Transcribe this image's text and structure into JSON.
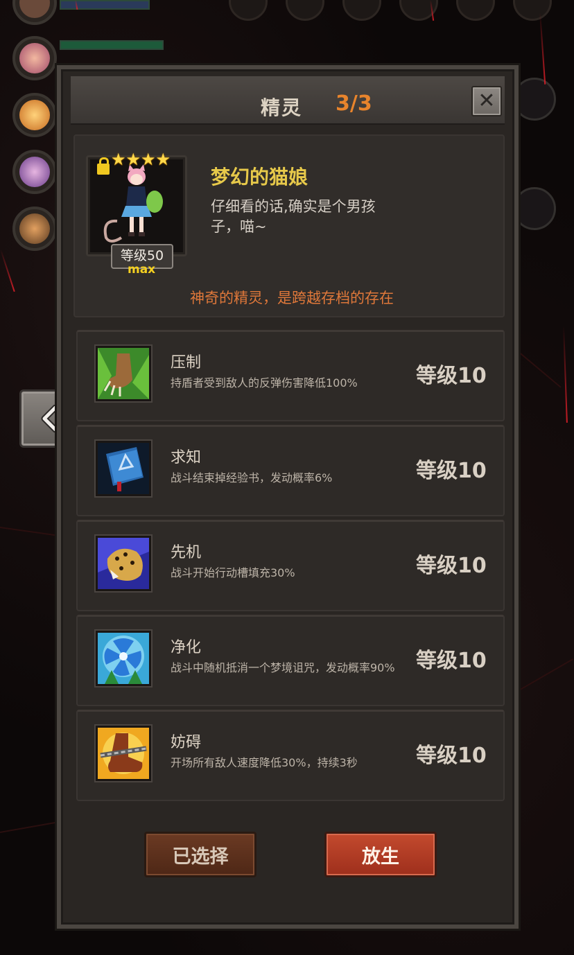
{
  "panel": {
    "title": "精灵",
    "count": "3/3",
    "close_icon": "close-icon"
  },
  "sprite": {
    "stars": "★★★★",
    "name": "梦幻的猫娘",
    "description": "仔细看的话,确实是个男孩子，喵~",
    "level_label": "等级50",
    "max_label": "max",
    "tagline": "神奇的精灵，是跨越存档的存在"
  },
  "skills": [
    {
      "name": "压制",
      "desc": "持盾者受到敌人的反弹伤害降低100%",
      "level": "等级10",
      "icon": "lion-paw-icon"
    },
    {
      "name": "求知",
      "desc": "战斗结束掉经验书，发动概率6%",
      "level": "等级10",
      "icon": "book-icon"
    },
    {
      "name": "先机",
      "desc": "战斗开始行动槽填充30%",
      "level": "等级10",
      "icon": "leopard-icon"
    },
    {
      "name": "净化",
      "desc": "战斗中随机抵消一个梦境诅咒，发动概率90%",
      "level": "等级10",
      "icon": "blue-flower-icon"
    },
    {
      "name": "妨碍",
      "desc": "开场所有敌人速度降低30%，持续3秒",
      "level": "等级10",
      "icon": "chained-boot-icon"
    }
  ],
  "buttons": {
    "selected": "已选择",
    "release": "放生"
  },
  "colors": {
    "count": "#e8842c",
    "name": "#e7c94a",
    "tagline": "#e0783a",
    "release_button": "#c34a2e",
    "selected_button": "#6b3a23"
  }
}
